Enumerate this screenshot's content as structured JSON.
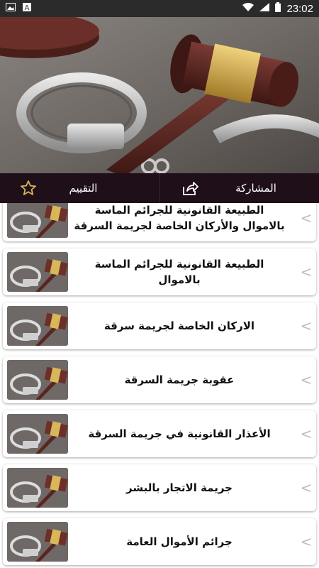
{
  "status_bar": {
    "time": "23:02",
    "left_icons": [
      "image-icon",
      "a-letter-icon"
    ],
    "right_icons": [
      "wifi-icon",
      "signal-icon",
      "battery-icon"
    ]
  },
  "actions": {
    "share_label": "المشاركة",
    "rate_label": "التقييم"
  },
  "colors": {
    "action_bar": "#1f0f19",
    "star": "#d6b25a"
  },
  "list": {
    "items": [
      {
        "title": "الطبيعة القانونية للجرائم الماسة بالاموال والأركان الخاصة لجريمة السرقة"
      },
      {
        "title": "الطبيعة القانونية للجرائم الماسة بالاموال"
      },
      {
        "title": "الاركان الخاصة لجريمة سرقة"
      },
      {
        "title": "عقوبة جريمة السرقة"
      },
      {
        "title": "الأعذار القانونية في جريمة السرقة"
      },
      {
        "title": "جريمة الاتجار بالبشر"
      },
      {
        "title": "جرائم الأموال العامة"
      }
    ]
  }
}
